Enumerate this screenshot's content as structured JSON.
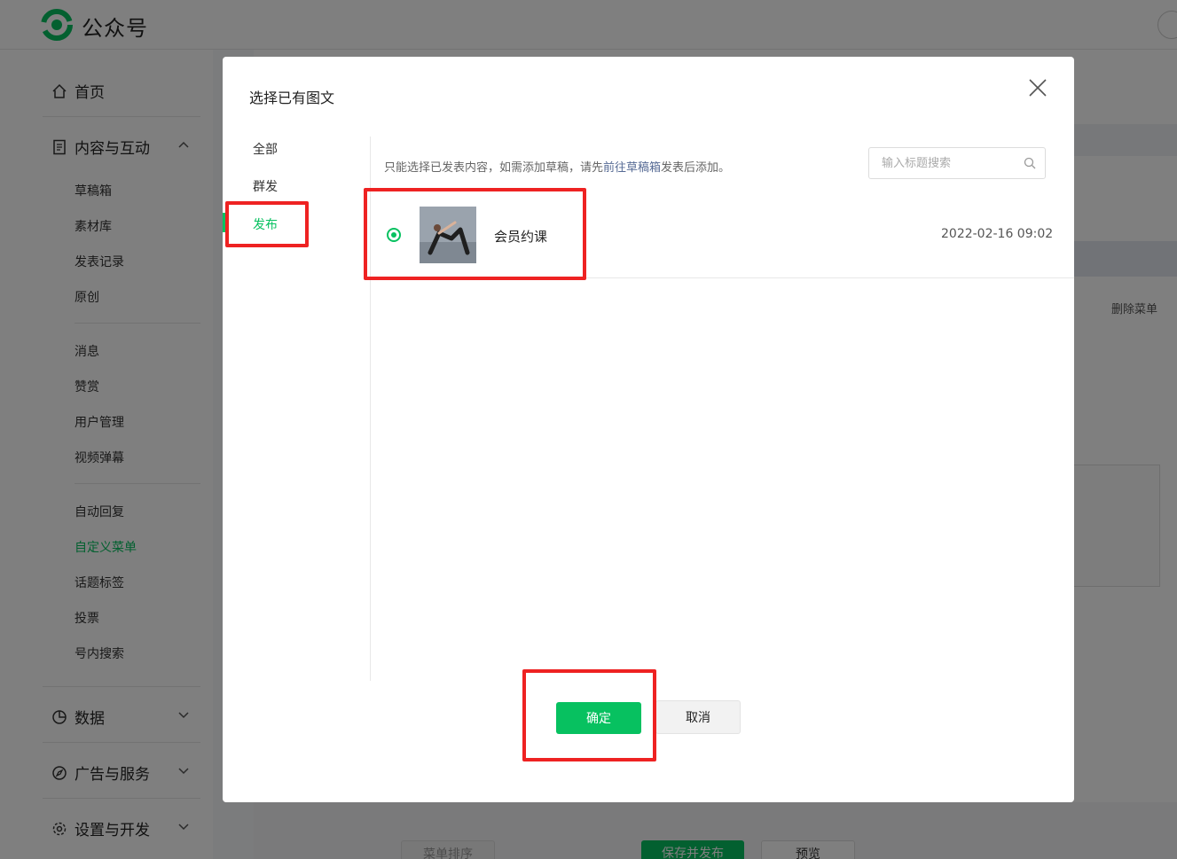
{
  "app": {
    "brand": "公众号"
  },
  "sidebar": {
    "home": "首页",
    "content_group": "内容与互动",
    "content_items": [
      "草稿箱",
      "素材库",
      "发表记录",
      "原创"
    ],
    "interaction_items": [
      "消息",
      "赞赏",
      "用户管理",
      "视频弹幕"
    ],
    "feature_items": [
      "自动回复",
      "自定义菜单",
      "话题标签",
      "投票",
      "号内搜索"
    ],
    "active_item": "自定义菜单",
    "data": "数据",
    "ads": "广告与服务",
    "settings": "设置与开发"
  },
  "background": {
    "delete_menu": "删除菜单",
    "sort_menu": "菜单排序",
    "save_publish": "保存并发布",
    "preview": "预览"
  },
  "dialog": {
    "title": "选择已有图文",
    "tabs": [
      "全部",
      "群发",
      "发布"
    ],
    "active_tab": "发布",
    "hint_prefix": "只能选择已发表内容，如需添加草稿，请先",
    "hint_link": "前往草稿箱",
    "hint_suffix": "发表后添加。",
    "search_placeholder": "输入标题搜索",
    "items": [
      {
        "title": "会员约课",
        "date": "2022-02-16 09:02",
        "selected": true
      }
    ],
    "confirm": "确定",
    "cancel": "取消"
  },
  "colors": {
    "accent": "#07c160",
    "highlight": "#ee2222",
    "link": "#576b95"
  }
}
